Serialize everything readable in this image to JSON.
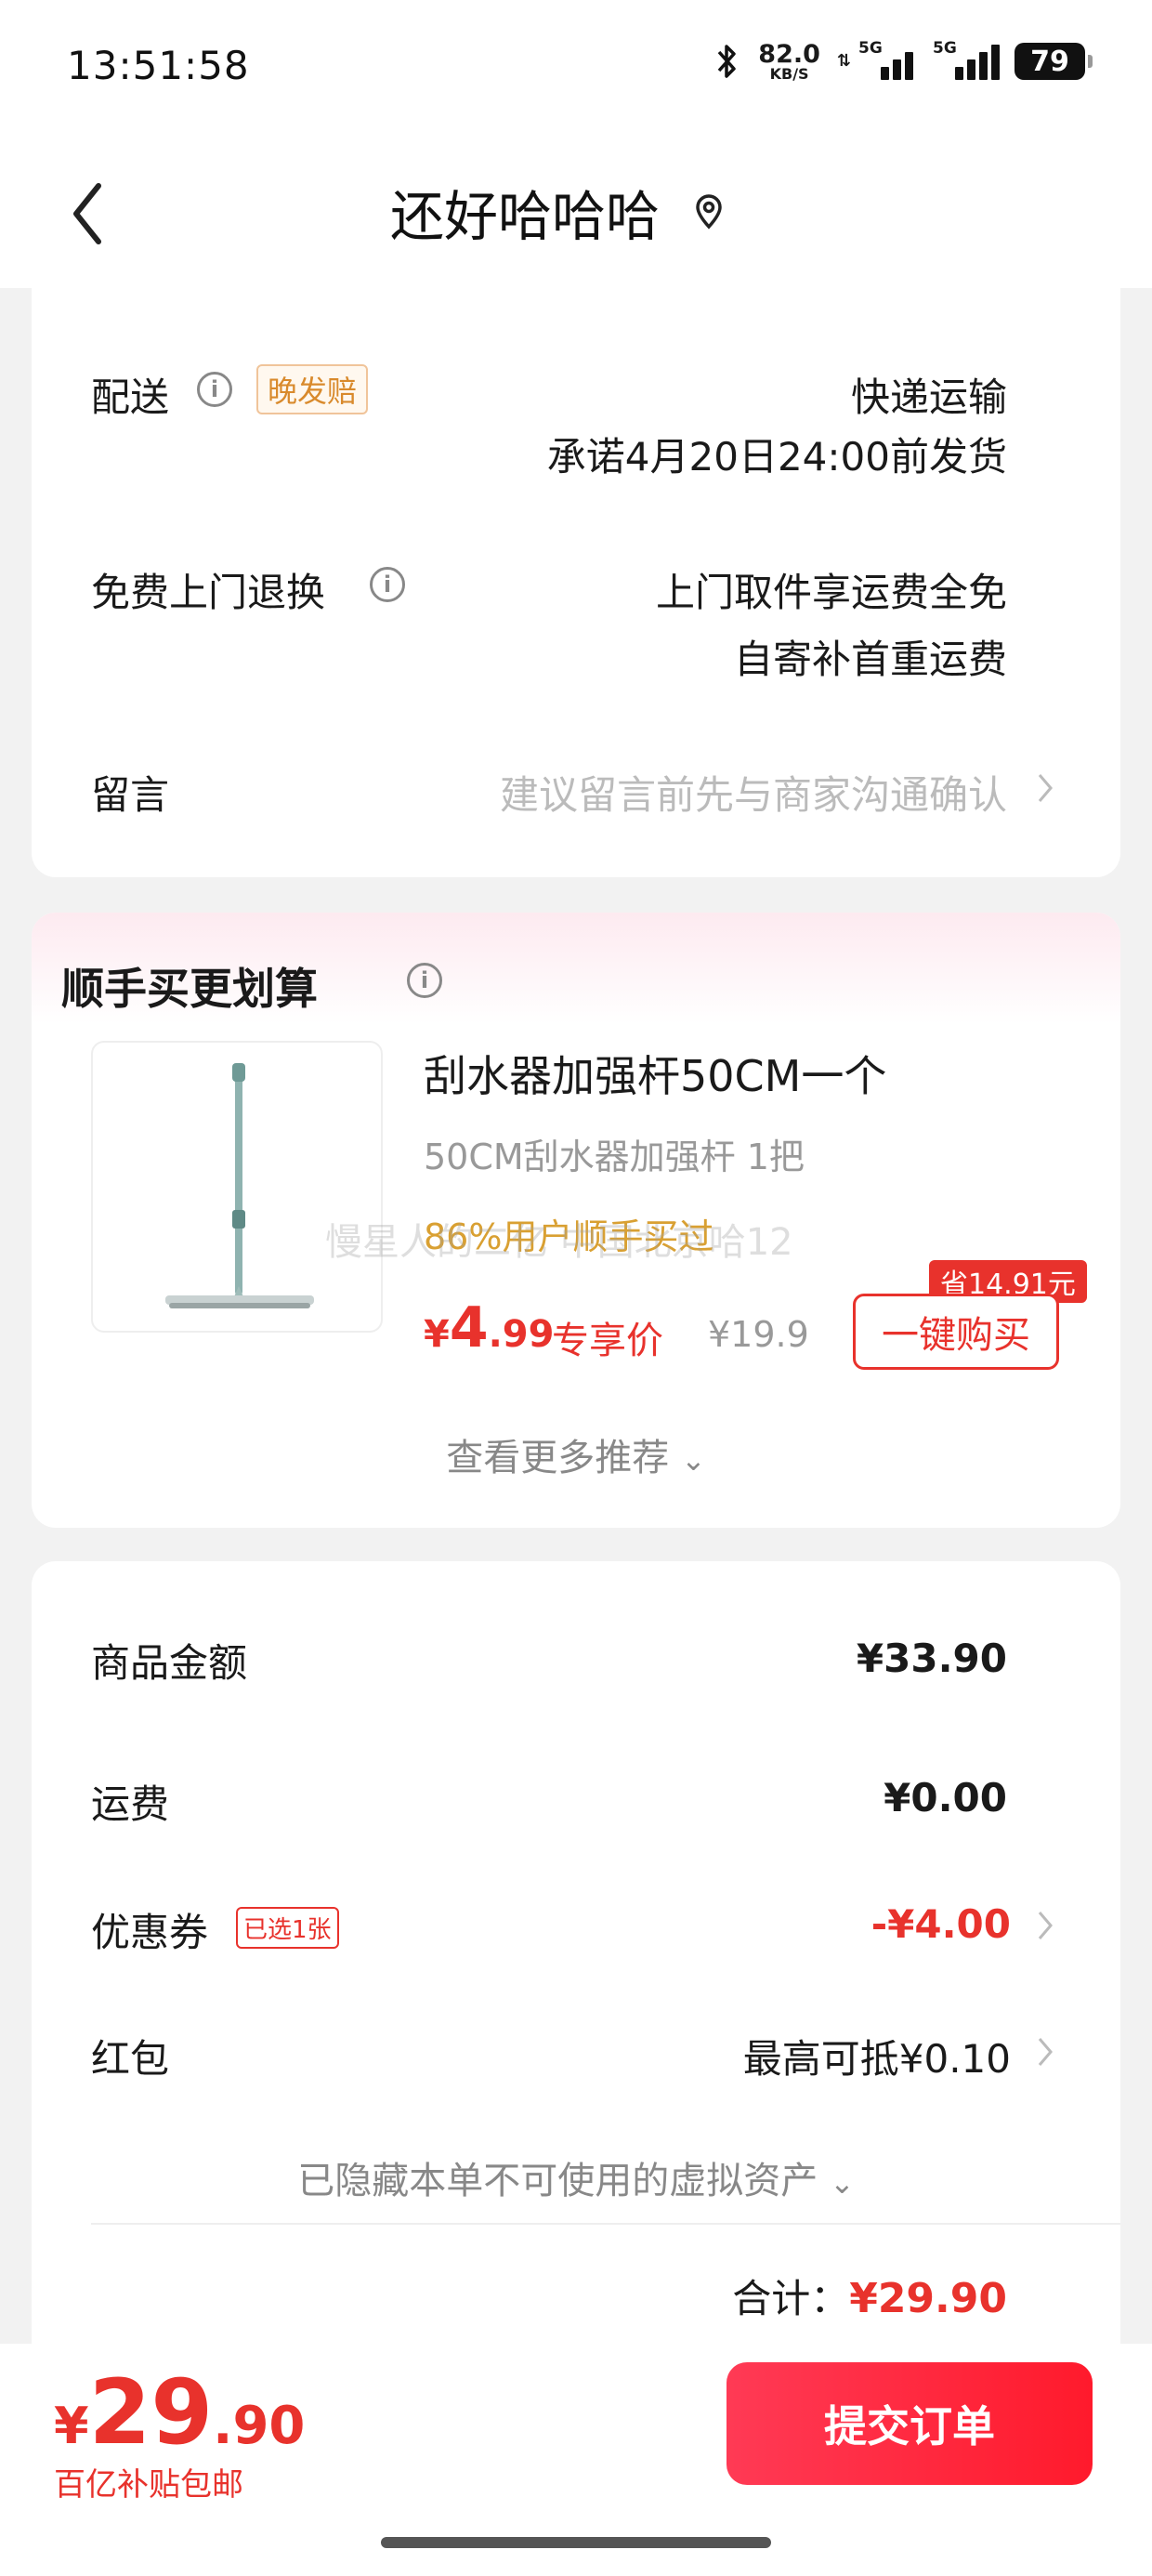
{
  "status_bar": {
    "time": "13:51:58",
    "net_speed_value": "82.0",
    "net_speed_unit": "KB/S",
    "signal_1_label": "5G",
    "signal_2_label": "5G",
    "battery": "79"
  },
  "nav": {
    "title": "还好哈哈哈"
  },
  "delivery": {
    "label": "配送",
    "badge": "晚发赔",
    "method": "快递运输",
    "promise": "承诺4月20日24:00前发货"
  },
  "return_service": {
    "label": "免费上门退换",
    "line1": "上门取件享运费全免",
    "line2": "自寄补首重运费"
  },
  "message": {
    "label": "留言",
    "placeholder": "建议留言前先与商家沟通确认"
  },
  "addon": {
    "section_title": "顺手买更划算",
    "product_title": "刮水器加强杆50CM一个",
    "product_spec": "50CM刮水器加强杆 1把",
    "buyers_text": "86%用户顺手买过",
    "price_currency": "¥",
    "price_int": "4",
    "price_dec": ".99",
    "exclusive_label": "专享价",
    "original_price": "¥19.9",
    "save_badge": "省14.91元",
    "buy_button": "一键购买",
    "more_label": "查看更多推荐"
  },
  "watermark": "慢星人的二亿 中国北京哈12",
  "summary": {
    "goods_label": "商品金额",
    "goods_value": "¥33.90",
    "shipping_label": "运费",
    "shipping_value": "¥0.00",
    "coupon_label": "优惠券",
    "coupon_tag": "已选1张",
    "coupon_value": "-¥4.00",
    "redpacket_label": "红包",
    "redpacket_value": "最高可抵¥0.10",
    "hidden_assets": "已隐藏本单不可使用的虚拟资产",
    "total_label": "合计：",
    "total_value": "¥29.90"
  },
  "bottom": {
    "price_currency": "¥",
    "price_int": "29",
    "price_dec": ".90",
    "subsidy": "百亿补贴包邮",
    "submit": "提交订单"
  },
  "colors": {
    "accent_red": "#e8322c",
    "badge_orange": "#d98a2c",
    "muted": "#999999"
  }
}
